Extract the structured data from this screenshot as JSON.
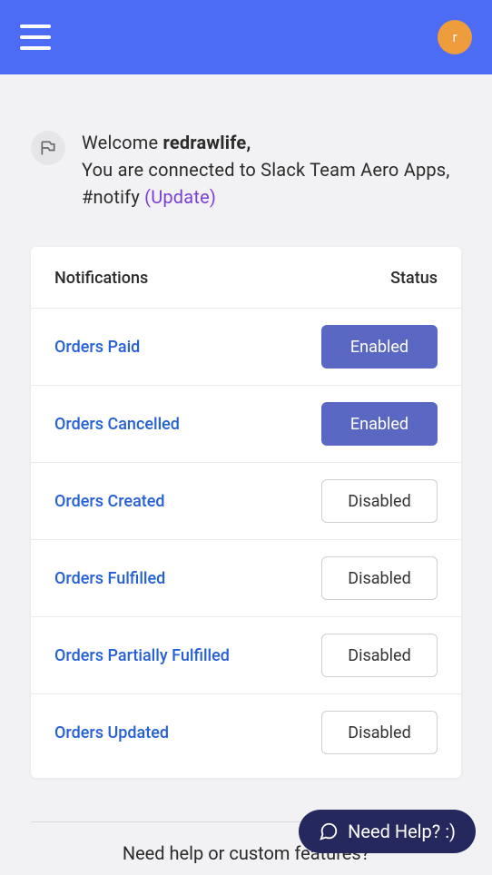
{
  "header": {
    "avatar_initial": "r"
  },
  "welcome": {
    "prefix": "Welcome ",
    "username": "redrawlife",
    "comma": ",",
    "line2a": "You are connected to Slack Team Aero Apps, #notify ",
    "update_label": "(Update)"
  },
  "table": {
    "col_notifications": "Notifications",
    "col_status": "Status",
    "enabled_label": "Enabled",
    "disabled_label": "Disabled",
    "rows": [
      {
        "label": "Orders Paid",
        "enabled": true
      },
      {
        "label": "Orders Cancelled",
        "enabled": true
      },
      {
        "label": "Orders Created",
        "enabled": false
      },
      {
        "label": "Orders Fulfilled",
        "enabled": false
      },
      {
        "label": "Orders Partially Fulfilled",
        "enabled": false
      },
      {
        "label": "Orders Updated",
        "enabled": false
      }
    ]
  },
  "footer": {
    "text": "Need help or custom features?"
  },
  "help": {
    "label": "Need Help? :)"
  }
}
